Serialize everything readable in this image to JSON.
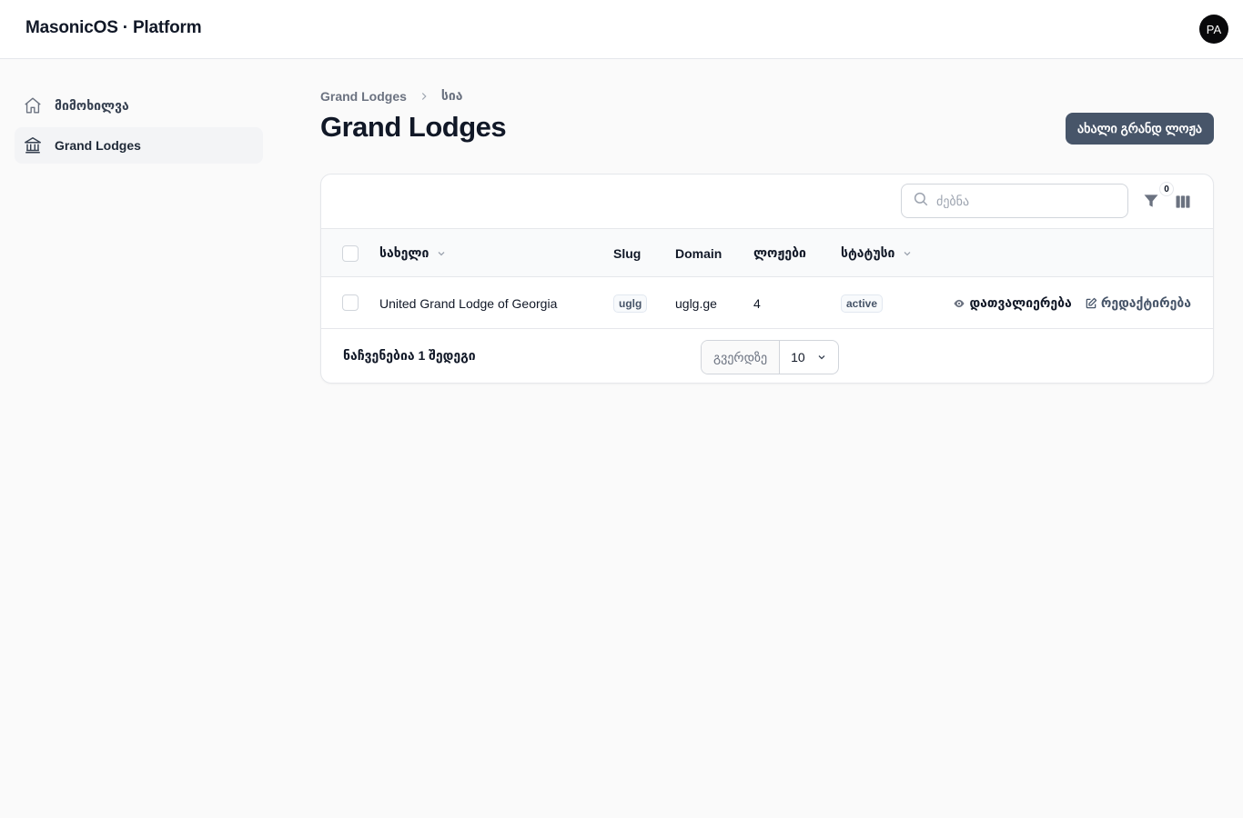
{
  "app": {
    "title": "MasonicOS · Platform",
    "avatar_initials": "PA"
  },
  "sidebar": {
    "items": [
      {
        "label": "მიმოხილვა",
        "icon": "home-icon",
        "active": false
      },
      {
        "label": "Grand Lodges",
        "icon": "building-columns-icon",
        "active": true
      }
    ]
  },
  "breadcrumb": {
    "items": [
      "Grand Lodges",
      "სია"
    ]
  },
  "page": {
    "title": "Grand Lodges",
    "new_button": "ახალი გრანდ ლოჟა"
  },
  "toolbar": {
    "search_placeholder": "ძებნა",
    "search_value": "",
    "filter_count": "0"
  },
  "table": {
    "columns": {
      "name": "სახელი",
      "slug": "Slug",
      "domain": "Domain",
      "lodges": "ლოჟები",
      "status": "სტატუსი"
    },
    "rows": [
      {
        "name": "United Grand Lodge of Georgia",
        "slug": "uglg",
        "domain": "uglg.ge",
        "lodges": "4",
        "status": "active",
        "view_label": "დათვალიერება",
        "edit_label": "რედაქტირება"
      }
    ]
  },
  "footer": {
    "results_text": "ნაჩვენებია 1 შედეგი",
    "per_page_label": "გვერდზე",
    "per_page_value": "10"
  },
  "colors": {
    "primary_button": "#475569",
    "avatar": "#09090b",
    "background": "#fafafa"
  }
}
